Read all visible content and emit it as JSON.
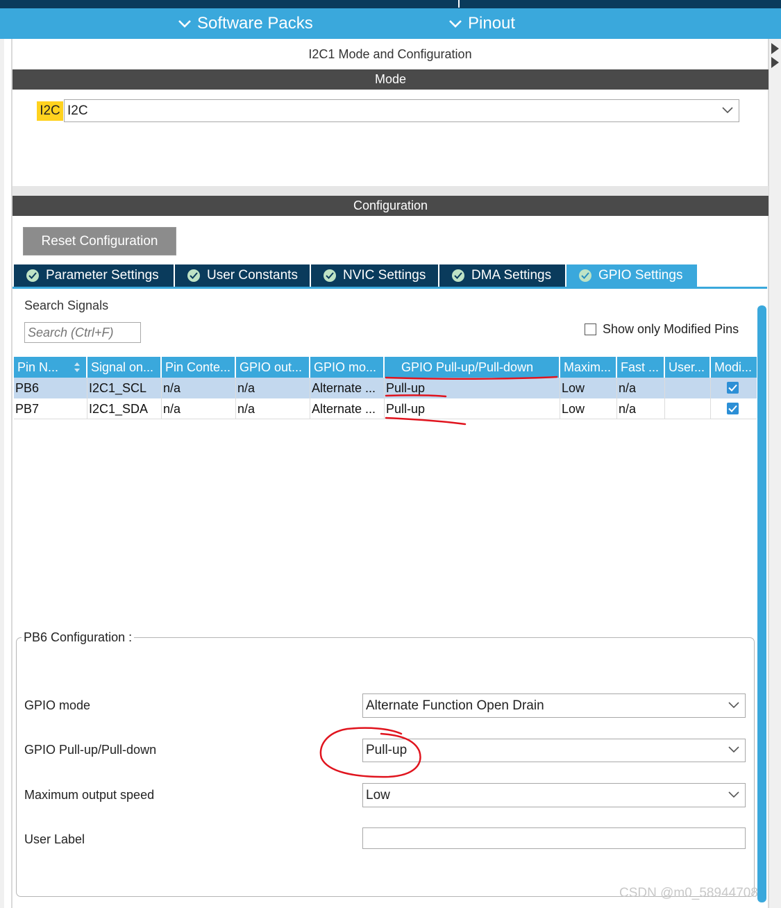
{
  "toolbar": {
    "software_packs": "Software Packs",
    "pinout": "Pinout"
  },
  "panel": {
    "title": "I2C1 Mode and Configuration",
    "mode_header": "Mode",
    "mode_label": "I2C",
    "mode_value": "I2C",
    "config_header": "Configuration",
    "reset_button": "Reset Configuration"
  },
  "tabs": [
    {
      "label": "Parameter Settings",
      "active": false
    },
    {
      "label": "User Constants",
      "active": false
    },
    {
      "label": "NVIC Settings",
      "active": false
    },
    {
      "label": "DMA Settings",
      "active": false
    },
    {
      "label": "GPIO Settings",
      "active": true
    }
  ],
  "search": {
    "label": "Search Signals",
    "placeholder": "Search (Ctrl+F)",
    "modified_only_label": "Show only Modified Pins",
    "modified_only_checked": false
  },
  "table": {
    "headers": [
      "Pin N...",
      "Signal on...",
      "Pin Conte...",
      "GPIO out...",
      "GPIO mo...",
      "GPIO Pull-up/Pull-down",
      "Maxim...",
      "Fast ...",
      "User...",
      "Modi..."
    ],
    "rows": [
      {
        "pin": "PB6",
        "signal": "I2C1_SCL",
        "context": "n/a",
        "output": "n/a",
        "mode": "Alternate ...",
        "pull": "Pull-up",
        "speed": "Low",
        "fast": "n/a",
        "user": "",
        "modified": true,
        "selected": true
      },
      {
        "pin": "PB7",
        "signal": "I2C1_SDA",
        "context": "n/a",
        "output": "n/a",
        "mode": "Alternate ...",
        "pull": "Pull-up",
        "speed": "Low",
        "fast": "n/a",
        "user": "",
        "modified": true,
        "selected": false
      }
    ]
  },
  "pin_config": {
    "title": "PB6 Configuration :",
    "gpio_mode_label": "GPIO mode",
    "gpio_mode_value": "Alternate Function Open Drain",
    "pull_label": "GPIO Pull-up/Pull-down",
    "pull_value": "Pull-up",
    "speed_label": "Maximum output speed",
    "speed_value": "Low",
    "user_label_label": "User Label",
    "user_label_value": ""
  },
  "watermark": "CSDN @m0_58944708",
  "colors": {
    "accent_blue": "#3aa8dc",
    "navy": "#0a3b5c",
    "section_gray": "#4a4a4a",
    "mode_label_yellow": "#ffd21f",
    "annotation_red": "#e0141e",
    "selected_row": "#c3d8ee"
  },
  "icons": {
    "toolbar_chevron": "chevron-down-icon",
    "tab_check": "check-circle-icon",
    "sort": "sort-arrows-icon",
    "select_chevron": "chevron-down-icon",
    "table_checkbox": "checkbox-checked-icon"
  }
}
